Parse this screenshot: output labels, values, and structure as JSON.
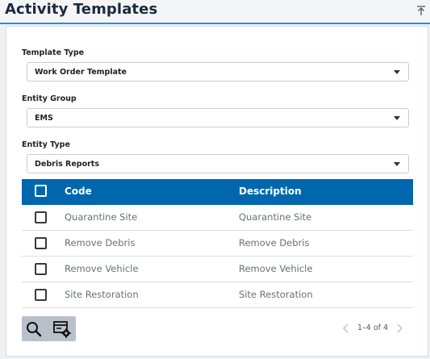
{
  "header": {
    "title": "Activity Templates",
    "collapse_icon": "collapse-up-icon"
  },
  "form": {
    "template_type": {
      "label": "Template Type",
      "value": "Work Order Template"
    },
    "entity_group": {
      "label": "Entity Group",
      "value": "EMS"
    },
    "entity_type": {
      "label": "Entity Type",
      "value": "Debris Reports"
    }
  },
  "table": {
    "columns": [
      "Code",
      "Description"
    ],
    "rows": [
      {
        "code": "Quarantine Site",
        "description": "Quarantine Site"
      },
      {
        "code": "Remove Debris",
        "description": "Remove Debris"
      },
      {
        "code": "Remove Vehicle",
        "description": "Remove Vehicle"
      },
      {
        "code": "Site Restoration",
        "description": "Site Restoration"
      }
    ]
  },
  "toolbar": {
    "search_icon": "search-icon",
    "settings_icon": "table-settings-icon"
  },
  "pager": {
    "text": "1–4 of 4"
  },
  "colors": {
    "header_accent": "#2d8fd6",
    "table_header": "#0067ae",
    "toolbar_bg": "#b9c0c9"
  }
}
